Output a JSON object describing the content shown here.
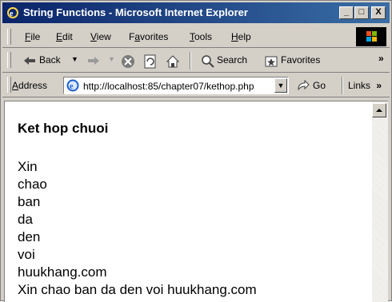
{
  "window": {
    "title": "String Functions - Microsoft Internet Explorer"
  },
  "titlebar_buttons": {
    "minimize": "_",
    "maximize": "□",
    "close": "X"
  },
  "menu": {
    "items": [
      {
        "label": "File",
        "key": "F",
        "rest": "ile"
      },
      {
        "label": "Edit",
        "key": "E",
        "rest": "dit"
      },
      {
        "label": "View",
        "key": "V",
        "rest": "iew"
      },
      {
        "label": "Favorites",
        "key": "a",
        "pre": "F",
        "rest": "vorites"
      },
      {
        "label": "Tools",
        "key": "T",
        "rest": "ools"
      },
      {
        "label": "Help",
        "key": "H",
        "rest": "elp"
      }
    ]
  },
  "toolbar": {
    "back_label": "Back",
    "search_label": "Search",
    "favorites_label": "Favorites",
    "overflow": "»"
  },
  "address": {
    "label_pre": "A",
    "label_rest": "ddress",
    "url": "http://localhost:85/chapter07/kethop.php",
    "go_label": "Go",
    "links_label": "Links",
    "links_overflow": "»"
  },
  "page": {
    "heading": "Ket hop chuoi",
    "lines": [
      "Xin",
      "chao",
      "ban",
      "da",
      "den",
      "voi",
      "huukhang.com",
      "Xin chao ban da den voi huukhang.com"
    ]
  }
}
